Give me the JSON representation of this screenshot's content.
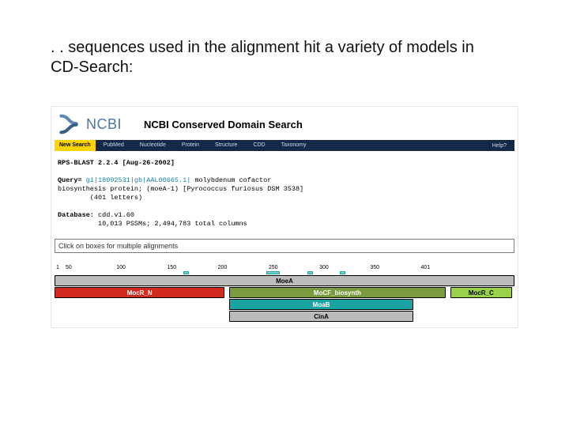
{
  "heading": ". . sequences used in the alignment hit a variety of models in CD-Search:",
  "logo_text": "NCBI",
  "header_title": "NCBI Conserved Domain Search",
  "nav": {
    "new_search": "New Search",
    "pubmed": "PubMed",
    "nucleotide": "Nucleotide",
    "protein": "Protein",
    "structure": "Structure",
    "cdd": "CDD",
    "taxonomy": "Taxonomy",
    "help": "Help?"
  },
  "mono": {
    "line1a": "RPS-BLAST 2.2.4 [Aug-26-2002]",
    "line2_label": "Query=",
    "line2_accession": " gi|18092531|gb|AAL00665.1|",
    "line2_rest": " molybdenum cofactor",
    "line3": "biosynthesis protein; (moeA-1) [Pyrococcus furiosus DSM 3538]",
    "line4": "        (401 letters)",
    "line5_label": "Database:",
    "line5_rest": " cdd.v1.60",
    "line6": "          10,013 PSSMs; 2,494,783 total columns"
  },
  "tip_placeholder": "Click on boxes for multiple alignments",
  "ruler": {
    "t0": "1",
    "t1": "50",
    "t2": "100",
    "t3": "150",
    "t4": "200",
    "t5": "250",
    "t6": "300",
    "t7": "350",
    "t8": "401"
  },
  "bars": {
    "moeA": "MoeA",
    "mocrN": "MocR_N",
    "mocf": "MoCF_biosynth",
    "moab": "MoaB",
    "mocrC": "MocR_C",
    "cina": "CinA"
  }
}
